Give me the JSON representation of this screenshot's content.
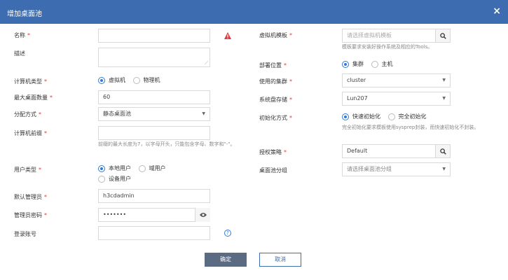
{
  "dialog": {
    "title": "增加桌面池",
    "close": "×"
  },
  "left": {
    "name_label": "名称",
    "name_value": "",
    "desc_label": "描述",
    "machine_type_label": "计算机类型",
    "machine_type_options": [
      "虚拟机",
      "物理机"
    ],
    "max_desktops_label": "最大桌面数量",
    "max_desktops_value": "60",
    "alloc_label": "分配方式",
    "alloc_value": "静态桌面池",
    "prefix_label": "计算机前缀",
    "prefix_hint": "前缀的最大长度为7，以字母开头，只能包含字母、数字和\"-\"。",
    "user_type_label": "用户类型",
    "user_type_options": [
      "本地用户",
      "域用户",
      "设备用户"
    ],
    "admin_label": "默认管理员",
    "admin_value": "h3cdadmin",
    "pwd_label": "管理员密码",
    "pwd_value": "•••••••",
    "login_label": "登录账号"
  },
  "right": {
    "template_label": "虚拟机模板",
    "template_placeholder": "请选择虚拟机模板",
    "template_hint": "模板要求安装好操作系统及相应的Tools。",
    "deploy_label": "部署位置",
    "deploy_options": [
      "集群",
      "主机"
    ],
    "cluster_label": "使用的集群",
    "cluster_value": "cluster",
    "storage_label": "系统盘存储",
    "storage_value": "Lun207",
    "init_label": "初始化方式",
    "init_options": [
      "快速初始化",
      "完全初始化"
    ],
    "init_hint": "完全初始化要求模板使用sysprep封装，而快速初始化不封装。",
    "auth_label": "授权策略",
    "auth_value": "Default",
    "group_label": "桌面池分组",
    "group_placeholder": "请选择桌面池分组"
  },
  "buttons": {
    "ok": "确定",
    "cancel": "取消"
  },
  "colors": {
    "header": "#3d6db0",
    "primary_button": "#5a6b82",
    "radio_checked": "#2f7bd9",
    "required": "#e0393e"
  }
}
